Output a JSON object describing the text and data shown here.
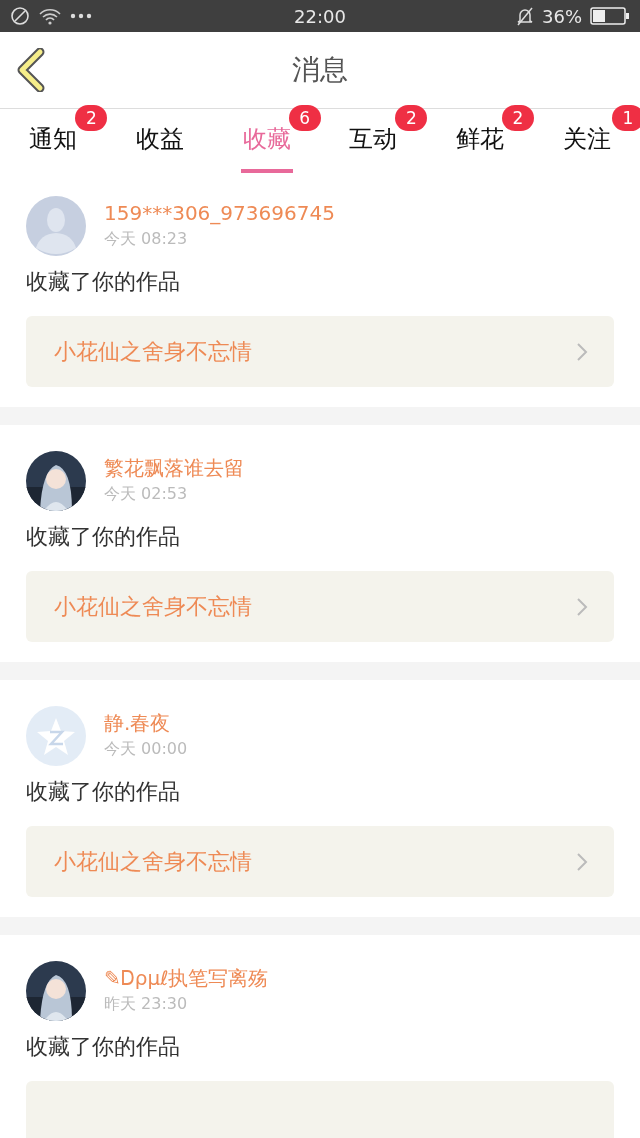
{
  "status_bar": {
    "time": "22:00",
    "battery": "36%"
  },
  "header": {
    "title": "消息"
  },
  "tabs": [
    {
      "label": "通知",
      "badge": "2",
      "selected": false
    },
    {
      "label": "收益",
      "selected": false
    },
    {
      "label": "收藏",
      "badge": "6",
      "selected": true
    },
    {
      "label": "互动",
      "badge": "2",
      "selected": false
    },
    {
      "label": "鲜花",
      "badge": "2",
      "selected": false
    },
    {
      "label": "关注",
      "badge": "1",
      "selected": false
    }
  ],
  "messages": [
    {
      "avatar": {
        "kind": "silhouette"
      },
      "user": "159***306_973696745",
      "time": "今天 08:23",
      "action": "收藏了你的作品",
      "work": "小花仙之舍身不忘情"
    },
    {
      "user": "繁花飘落谁去留",
      "time": "今天 02:53",
      "action": "收藏了你的作品",
      "work": "小花仙之舍身不忘情"
    },
    {
      "avatar": {
        "kind": "star"
      },
      "user": "静.春夜",
      "time": "今天 00:00",
      "action": "收藏了你的作品",
      "work": "小花仙之舍身不忘情"
    },
    {
      "user": "✎Ꭰρμℓ执笔写离殇",
      "time": "昨天 23:30",
      "action": "收藏了你的作品"
    }
  ]
}
